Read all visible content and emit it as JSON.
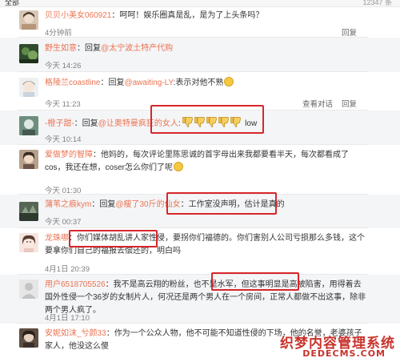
{
  "header": {
    "left": "全部",
    "right": "12347 条"
  },
  "comments": [
    {
      "user": "贝贝小美女060921",
      "sep": "：",
      "text": "呵呵！娱乐圈真是乱，是为了上头条吗？",
      "time": "4分钟前",
      "reply": "回复"
    },
    {
      "user": "野生如意",
      "sep": "：回复",
      "mention": "@太宁波土特产代购",
      "text": "",
      "time": "今天 14:26",
      "reply": "回复"
    },
    {
      "user": "格陵兰coastline",
      "sep": "：回复",
      "mention": "@awaiting-LY",
      "text": ":表示对他不熟",
      "time": "今天 11:23",
      "convo": "查看对话",
      "reply": "回复"
    },
    {
      "user": "-橙子甜-",
      "sep": "：回复",
      "mention": "@让奥特曼疯狂的女人",
      "text": ":",
      "low": "low",
      "time": "今天 10:14",
      "reply": "回复"
    },
    {
      "user": "爱做梦的智障",
      "sep": "：",
      "text": "他妈的，每次评论里陈思诚的首字母出来我都要看半天，每次都看成了cos，我还在想，coser怎么你们了呢",
      "time": "今天 01:30",
      "reply": "回复"
    },
    {
      "user": "蒲苇之痕kym",
      "sep": "：回复",
      "mention": "@瘦了30斤的仙女",
      "text": "：工作室没声明，估计是真的",
      "time": "今天 00:37",
      "reply": "回复"
    },
    {
      "user": "龙珠哪",
      "sep": "：",
      "text": "你们媒体胡乱讲人家性侵，要拐你们福德的。你们害别人公司亏损那么多钱，这个要拿你们自己的福报去偿还的，明白吗",
      "time": "4月1日 20:39",
      "reply": "回复"
    },
    {
      "user": "用户6518705526",
      "sep": "：",
      "text": "我不是高云翔的粉丝，也不是水军，但这事明显是高被陷害，用得着去国外性侵一个36岁的女制片人，何况还是两个男人在一个房间，正常人都做不出这事，除非两个男人疯了。",
      "time": "4月1日 17:10",
      "reply": "回复"
    },
    {
      "user": "安妮如沫_兮颜33",
      "sep": "：",
      "text": "作为一个公众人物，他不可能不知道性侵的下场，他的名誉，老婆孩子家人，他没这么傻",
      "time": "",
      "reply": ""
    }
  ],
  "watermark": {
    "line1": "织梦内容管理系统",
    "line2": "DEDECMS.COM"
  },
  "colors": {
    "username": "#eb7350",
    "highlight": "#d7262b",
    "rowGray": "#f4f5f7"
  },
  "icons": [
    "thumbs-down-icon",
    "laugh-emoji-icon",
    "avatar"
  ]
}
